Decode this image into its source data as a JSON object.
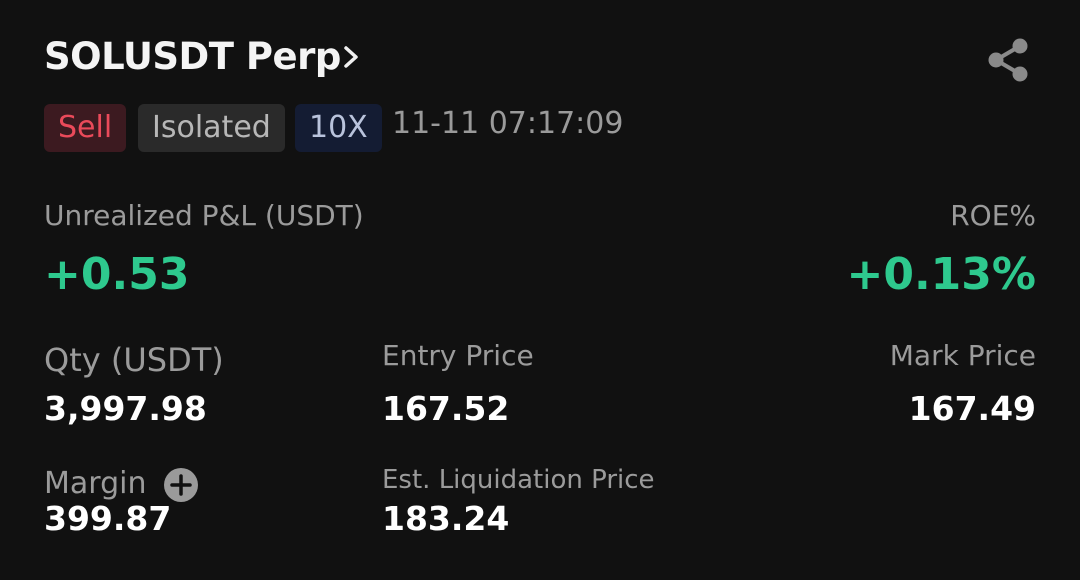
{
  "header": {
    "title": "SOLUSDT Perp"
  },
  "tags": {
    "side": "Sell",
    "margin_mode": "Isolated",
    "leverage": "10X",
    "timestamp": "11-11 07:17:09"
  },
  "pnl": {
    "label": "Unrealized P&L (USDT)",
    "value": "+0.53",
    "roe_label": "ROE%",
    "roe_value": "+0.13%"
  },
  "stats": {
    "qty_label": "Qty (USDT)",
    "qty_value": "3,997.98",
    "entry_label": "Entry Price",
    "entry_value": "167.52",
    "mark_label": "Mark Price",
    "mark_value": "167.49",
    "margin_label": "Margin",
    "margin_value": "399.87",
    "liq_label": "Est. Liquidation Price",
    "liq_value": "183.24"
  },
  "colors": {
    "background": "#111111",
    "profit_green": "#2ec98e",
    "sell_red": "#ea4a5a"
  }
}
